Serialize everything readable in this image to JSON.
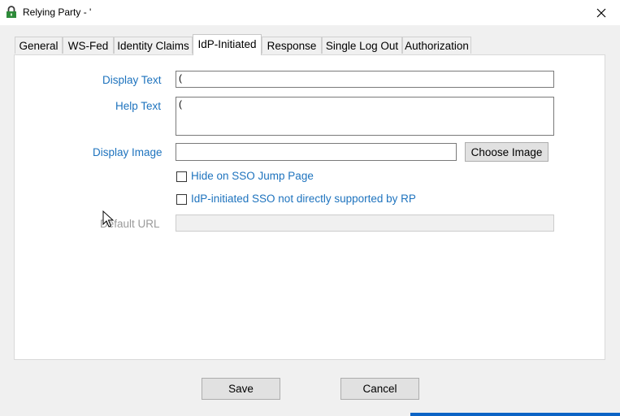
{
  "window": {
    "title": "Relying Party - '",
    "close_icon": "close-icon"
  },
  "tabs": [
    {
      "label": "General",
      "active": false
    },
    {
      "label": "WS-Fed",
      "active": false
    },
    {
      "label": "Identity Claims",
      "active": false
    },
    {
      "label": "IdP-Initiated",
      "active": true
    },
    {
      "label": "Response",
      "active": false
    },
    {
      "label": "Single Log Out",
      "active": false
    },
    {
      "label": "Authorization",
      "active": false
    }
  ],
  "form": {
    "display_text_label": "Display Text",
    "display_text_value": "(",
    "help_text_label": "Help Text",
    "help_text_value": "(",
    "display_image_label": "Display Image",
    "display_image_value": "",
    "choose_image_label": "Choose Image",
    "hide_sso_label": "Hide on SSO Jump Page",
    "hide_sso_checked": false,
    "idp_not_supported_label": "IdP-initiated SSO not directly supported by RP",
    "idp_not_supported_checked": false,
    "default_url_label": "Default URL",
    "default_url_value": ""
  },
  "footer": {
    "save_label": "Save",
    "cancel_label": "Cancel"
  },
  "colors": {
    "label_blue": "#1e73be",
    "disabled_gray": "#9a9a9a",
    "taskbar_blue": "#0b63c5"
  }
}
